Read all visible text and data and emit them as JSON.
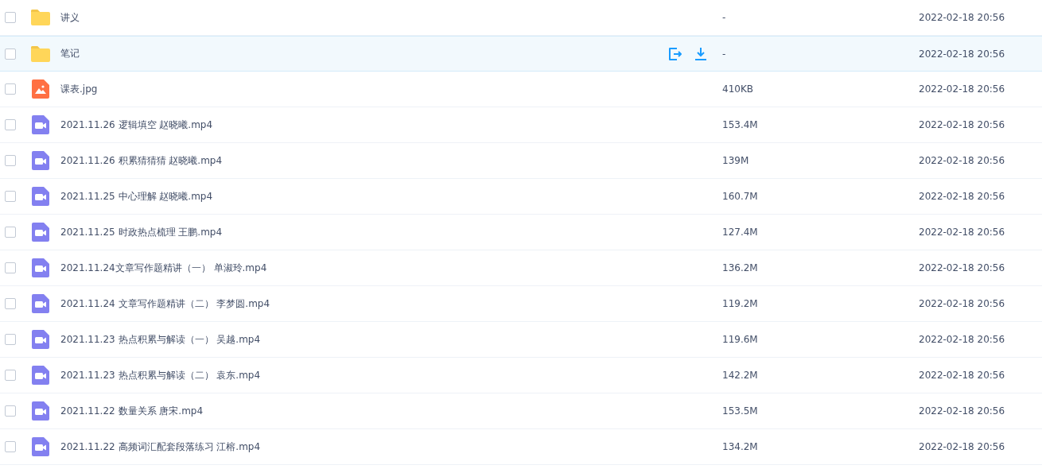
{
  "files": [
    {
      "kind": "folder",
      "name": "讲义",
      "size": "-",
      "modified": "2022-02-18 20:56",
      "checked": false,
      "hovered": false
    },
    {
      "kind": "folder",
      "name": "笔记",
      "size": "-",
      "modified": "2022-02-18 20:56",
      "checked": false,
      "hovered": true
    },
    {
      "kind": "image",
      "name": "课表.jpg",
      "size": "410KB",
      "modified": "2022-02-18 20:56",
      "checked": false,
      "hovered": false
    },
    {
      "kind": "video",
      "name": "2021.11.26 逻辑填空 赵晓曦.mp4",
      "size": "153.4M",
      "modified": "2022-02-18 20:56",
      "checked": false,
      "hovered": false
    },
    {
      "kind": "video",
      "name": "2021.11.26 积累猜猜猜 赵晓曦.mp4",
      "size": "139M",
      "modified": "2022-02-18 20:56",
      "checked": false,
      "hovered": false
    },
    {
      "kind": "video",
      "name": "2021.11.25 中心理解 赵晓曦.mp4",
      "size": "160.7M",
      "modified": "2022-02-18 20:56",
      "checked": false,
      "hovered": false
    },
    {
      "kind": "video",
      "name": "2021.11.25 时政热点梳理 王鹏.mp4",
      "size": "127.4M",
      "modified": "2022-02-18 20:56",
      "checked": false,
      "hovered": false
    },
    {
      "kind": "video",
      "name": "2021.11.24文章写作题精讲（一） 单淑玲.mp4",
      "size": "136.2M",
      "modified": "2022-02-18 20:56",
      "checked": false,
      "hovered": false
    },
    {
      "kind": "video",
      "name": "2021.11.24 文章写作题精讲（二） 李梦圆.mp4",
      "size": "119.2M",
      "modified": "2022-02-18 20:56",
      "checked": false,
      "hovered": false
    },
    {
      "kind": "video",
      "name": "2021.11.23 热点积累与解读（一） 吴越.mp4",
      "size": "119.6M",
      "modified": "2022-02-18 20:56",
      "checked": false,
      "hovered": false
    },
    {
      "kind": "video",
      "name": "2021.11.23 热点积累与解读（二） 袁东.mp4",
      "size": "142.2M",
      "modified": "2022-02-18 20:56",
      "checked": false,
      "hovered": false
    },
    {
      "kind": "video",
      "name": "2021.11.22 数量关系 唐宋.mp4",
      "size": "153.5M",
      "modified": "2022-02-18 20:56",
      "checked": false,
      "hovered": false
    },
    {
      "kind": "video",
      "name": "2021.11.22 高频词汇配套段落练习 江榕.mp4",
      "size": "134.2M",
      "modified": "2022-02-18 20:56",
      "checked": false,
      "hovered": false
    }
  ]
}
